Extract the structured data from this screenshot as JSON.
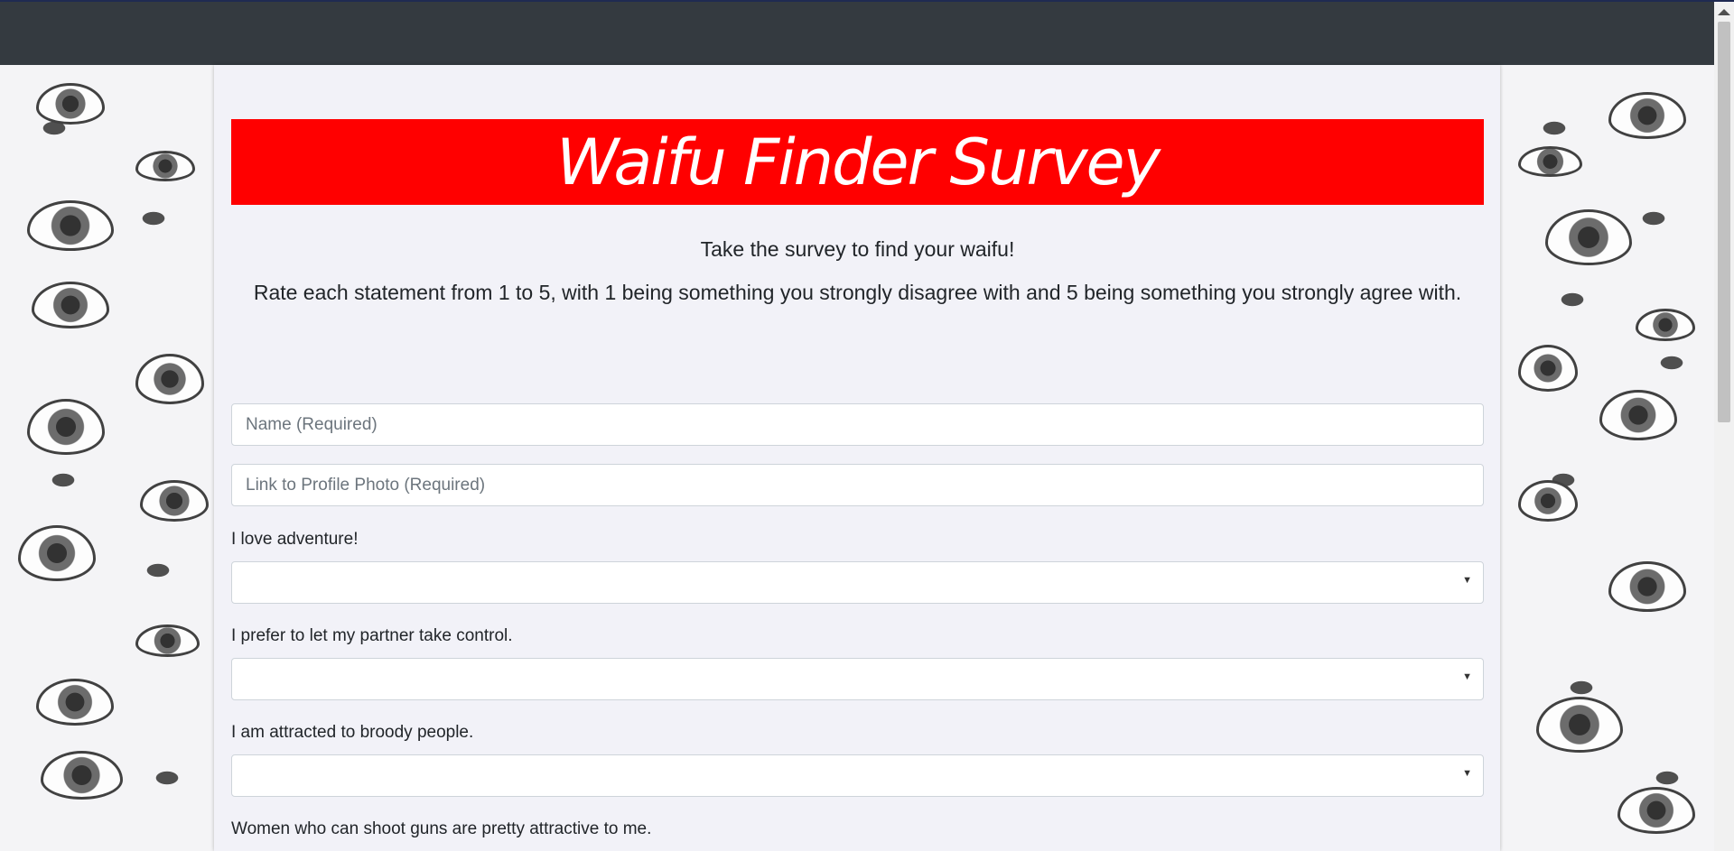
{
  "banner": {
    "title": "Waifu Finder Survey",
    "bg_color": "#ff0000"
  },
  "intro": {
    "line1": "Take the survey to find your waifu!",
    "line2": "Rate each statement from 1 to 5, with 1 being something you strongly disagree with and 5 being something you strongly agree with."
  },
  "form": {
    "name_placeholder": "Name (Required)",
    "photo_placeholder": "Link to Profile Photo (Required)",
    "questions": [
      {
        "label": "I love adventure!",
        "selected": ""
      },
      {
        "label": "I prefer to let my partner take control.",
        "selected": ""
      },
      {
        "label": "I am attracted to broody people.",
        "selected": ""
      },
      {
        "label": "Women who can shoot guns are pretty attractive to me."
      }
    ]
  },
  "icons": {
    "select_caret": "caret-down-icon"
  },
  "colors": {
    "navbar": "#343a40",
    "card": "#f2f2f8"
  }
}
